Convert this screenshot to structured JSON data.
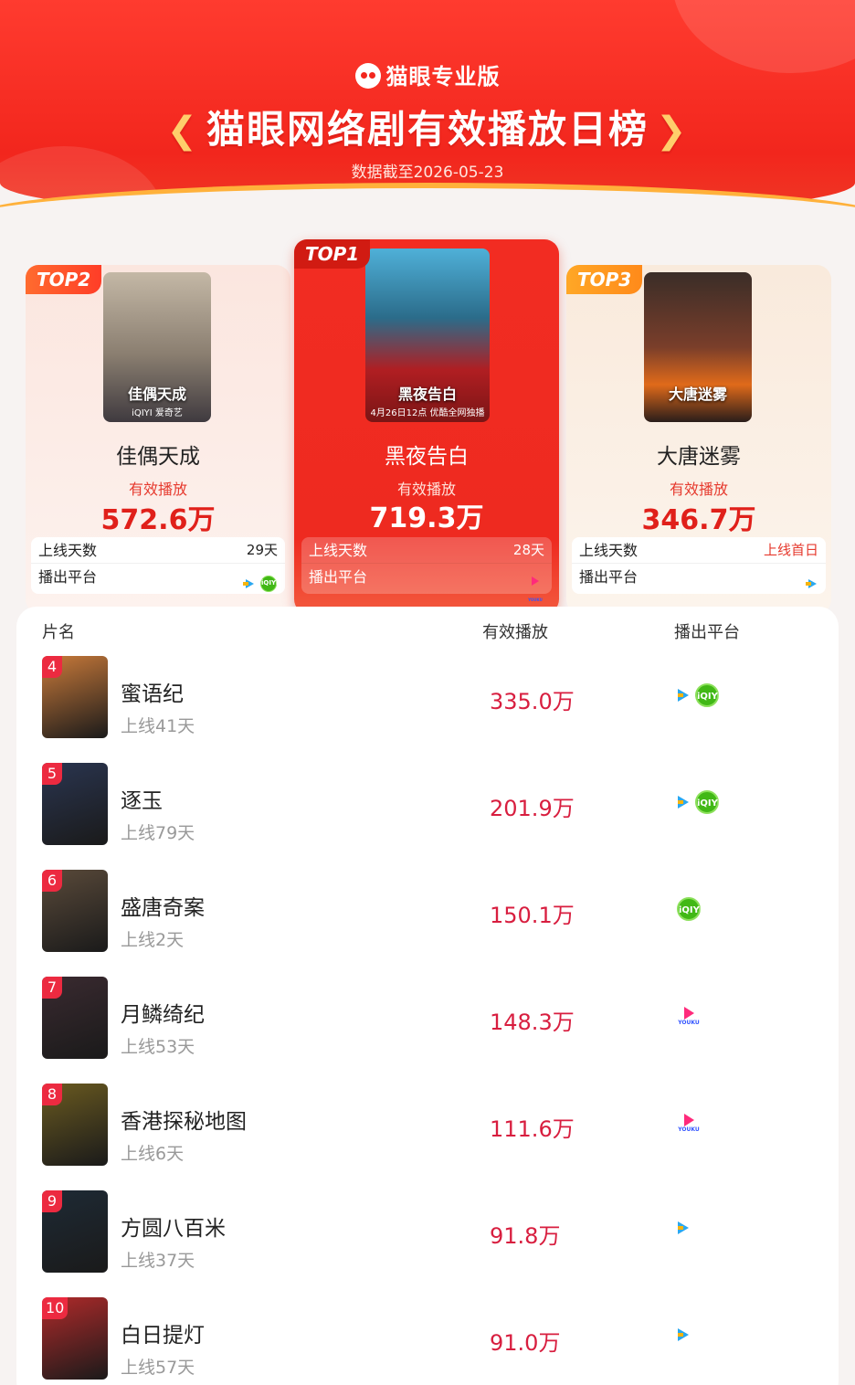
{
  "header": {
    "brand": "猫眼专业版",
    "title": "猫眼网络剧有效播放日榜",
    "date": "数据截至2026-05-23"
  },
  "podium": {
    "top1": {
      "tag": "TOP1",
      "name": "黑夜告白",
      "metric_label": "有效播放",
      "value": "719.3万",
      "days_label": "上线天数",
      "days": "28天",
      "platform_label": "播出平台",
      "platforms": [
        "youku"
      ],
      "poster_title": "黑夜告白",
      "poster_sub": "4月26日12点 优酷全网独播"
    },
    "top2": {
      "tag": "TOP2",
      "name": "佳偶天成",
      "metric_label": "有效播放",
      "value": "572.6万",
      "days_label": "上线天数",
      "days": "29天",
      "platform_label": "播出平台",
      "platforms": [
        "tencent",
        "iqiyi"
      ],
      "poster_title": "佳偶天成",
      "poster_sub": "iQIYI 爱奇艺"
    },
    "top3": {
      "tag": "TOP3",
      "name": "大唐迷雾",
      "metric_label": "有效播放",
      "value": "346.7万",
      "days_label": "上线天数",
      "days": "上线首日",
      "platform_label": "播出平台",
      "platforms": [
        "tencent"
      ],
      "poster_title": "大唐迷雾"
    }
  },
  "list": {
    "headers": [
      "片名",
      "有效播放",
      "播出平台"
    ],
    "rows": [
      {
        "rank": "4",
        "name": "蜜语纪",
        "days": "上线41天",
        "value": "335.0万",
        "platforms": [
          "tencent",
          "iqiyi"
        ],
        "color": "#c97a3a"
      },
      {
        "rank": "5",
        "name": "逐玉",
        "days": "上线79天",
        "value": "201.9万",
        "platforms": [
          "tencent",
          "iqiyi"
        ],
        "color": "#2a3550"
      },
      {
        "rank": "6",
        "name": "盛唐奇案",
        "days": "上线2天",
        "value": "150.1万",
        "platforms": [
          "iqiyi"
        ],
        "color": "#5a4a3a"
      },
      {
        "rank": "7",
        "name": "月鳞绮纪",
        "days": "上线53天",
        "value": "148.3万",
        "platforms": [
          "youku"
        ],
        "color": "#3a2a30"
      },
      {
        "rank": "8",
        "name": "香港探秘地图",
        "days": "上线6天",
        "value": "111.6万",
        "platforms": [
          "youku"
        ],
        "color": "#6a5a20"
      },
      {
        "rank": "9",
        "name": "方圆八百米",
        "days": "上线37天",
        "value": "91.8万",
        "platforms": [
          "tencent"
        ],
        "color": "#1e2a35"
      },
      {
        "rank": "10",
        "name": "白日提灯",
        "days": "上线57天",
        "value": "91.0万",
        "platforms": [
          "tencent"
        ],
        "color": "#b02a2a"
      }
    ]
  },
  "icons": {
    "tencent": "tencent-video-icon",
    "iqiyi": "iqiyi-icon",
    "youku": "youku-icon"
  }
}
